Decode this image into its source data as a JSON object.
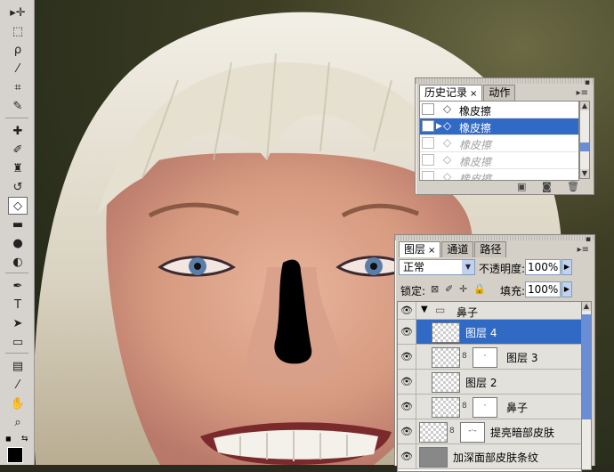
{
  "toolbox": {
    "tools": [
      {
        "name": "move-tool",
        "glyph": "▸✛"
      },
      {
        "name": "marquee-tool",
        "glyph": "⬚"
      },
      {
        "name": "lasso-tool",
        "glyph": "ρ"
      },
      {
        "name": "magic-wand-tool",
        "glyph": "⁄"
      },
      {
        "name": "crop-tool",
        "glyph": "⌗"
      },
      {
        "name": "slice-tool",
        "glyph": "✎"
      },
      {
        "name": "healing-brush-tool",
        "glyph": "✚"
      },
      {
        "name": "brush-tool",
        "glyph": "✐"
      },
      {
        "name": "clone-stamp-tool",
        "glyph": "♜"
      },
      {
        "name": "history-brush-tool",
        "glyph": "↺"
      },
      {
        "name": "eraser-tool",
        "glyph": "◇",
        "active": true
      },
      {
        "name": "gradient-tool",
        "glyph": "▬"
      },
      {
        "name": "blur-tool",
        "glyph": "●"
      },
      {
        "name": "dodge-tool",
        "glyph": "◐"
      },
      {
        "name": "pen-tool",
        "glyph": "✒"
      },
      {
        "name": "type-tool",
        "glyph": "T"
      },
      {
        "name": "path-selection-tool",
        "glyph": "➤"
      },
      {
        "name": "shape-tool",
        "glyph": "▭"
      },
      {
        "name": "notes-tool",
        "glyph": "▤"
      },
      {
        "name": "eyedropper-tool",
        "glyph": "⁄"
      },
      {
        "name": "hand-tool",
        "glyph": "✋"
      },
      {
        "name": "zoom-tool",
        "glyph": "⌕"
      }
    ]
  },
  "history_panel": {
    "tabs": [
      {
        "label": "历史记录",
        "active": true,
        "close": "×"
      },
      {
        "label": "动作",
        "active": false
      }
    ],
    "items": [
      {
        "label": "橡皮擦",
        "state": "normal"
      },
      {
        "label": "橡皮擦",
        "state": "selected"
      },
      {
        "label": "橡皮擦",
        "state": "dim"
      },
      {
        "label": "橡皮擦",
        "state": "dim"
      },
      {
        "label": "橡皮擦",
        "state": "dim"
      }
    ]
  },
  "layers_panel": {
    "tabs": [
      {
        "label": "图层",
        "active": true,
        "close": "×"
      },
      {
        "label": "通道",
        "active": false
      },
      {
        "label": "路径",
        "active": false
      }
    ],
    "blend_mode": "正常",
    "opacity_label": "不透明度:",
    "opacity_value": "100%",
    "lock_label": "锁定:",
    "fill_label": "填充:",
    "fill_value": "100%",
    "layers": [
      {
        "name": "鼻子",
        "kind": "group"
      },
      {
        "name": "图层 4",
        "kind": "layer",
        "selected": true
      },
      {
        "name": "图层 3",
        "kind": "layer-mask"
      },
      {
        "name": "图层 2",
        "kind": "layer"
      },
      {
        "name": "鼻子",
        "kind": "layer-mask"
      },
      {
        "name": "提亮暗部皮肤",
        "kind": "adjustment"
      },
      {
        "name": "加深面部皮肤条纹",
        "kind": "gray"
      }
    ]
  },
  "colors": {
    "selection": "#316ac5",
    "panel_bg": "#d4d0c8"
  }
}
